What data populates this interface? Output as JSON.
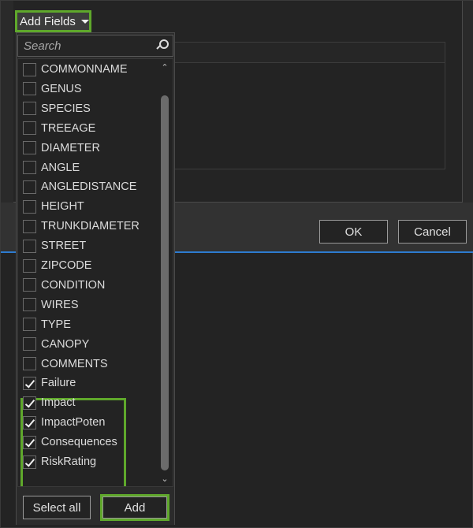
{
  "add_fields_button": {
    "label": "Add Fields",
    "icon": "caret-down-icon"
  },
  "dialog": {
    "ok_label": "OK",
    "cancel_label": "Cancel"
  },
  "popup": {
    "search": {
      "placeholder": "Search",
      "value": "",
      "icon": "search-icon"
    },
    "fields": [
      {
        "label": "COMMONNAME",
        "checked": false
      },
      {
        "label": "GENUS",
        "checked": false
      },
      {
        "label": "SPECIES",
        "checked": false
      },
      {
        "label": "TREEAGE",
        "checked": false
      },
      {
        "label": "DIAMETER",
        "checked": false
      },
      {
        "label": "ANGLE",
        "checked": false
      },
      {
        "label": "ANGLEDISTANCE",
        "checked": false
      },
      {
        "label": "HEIGHT",
        "checked": false
      },
      {
        "label": "TRUNKDIAMETER",
        "checked": false
      },
      {
        "label": "STREET",
        "checked": false
      },
      {
        "label": "ZIPCODE",
        "checked": false
      },
      {
        "label": "CONDITION",
        "checked": false
      },
      {
        "label": "WIRES",
        "checked": false
      },
      {
        "label": "TYPE",
        "checked": false
      },
      {
        "label": "CANOPY",
        "checked": false
      },
      {
        "label": "COMMENTS",
        "checked": false
      },
      {
        "label": "Failure",
        "checked": true
      },
      {
        "label": "Impact",
        "checked": true
      },
      {
        "label": "ImpactPoten",
        "checked": true
      },
      {
        "label": "Consequences",
        "checked": true
      },
      {
        "label": "RiskRating",
        "checked": true
      }
    ],
    "select_all_label": "Select all",
    "add_label": "Add"
  },
  "colors": {
    "highlight": "#5fa82b",
    "accent_line": "#2d7bd0"
  }
}
